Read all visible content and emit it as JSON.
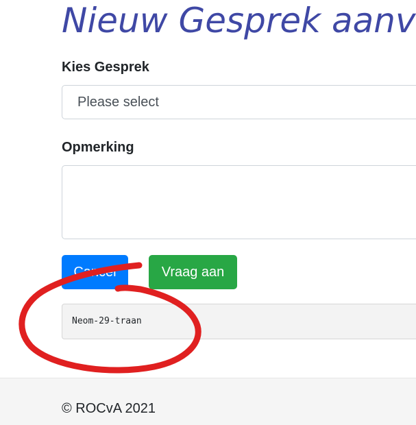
{
  "page": {
    "title": "Nieuw Gesprek aanvraag"
  },
  "form": {
    "gesprek_label": "Kies Gesprek",
    "gesprek_select": {
      "selected": "Please select"
    },
    "opmerking_label": "Opmerking",
    "opmerking_value": "",
    "cancel_label": "Cancel",
    "submit_label": "Vraag aan"
  },
  "code_block": {
    "text": "Neom-29-traan"
  },
  "annotation": {
    "kind": "red-circle-marker",
    "color": "#e02020"
  },
  "footer": {
    "text": "© ROCvA 2021"
  },
  "colors": {
    "title": "#3f48a5",
    "primary": "#007bff",
    "success": "#28a745",
    "footer_bg": "#f5f5f5"
  }
}
